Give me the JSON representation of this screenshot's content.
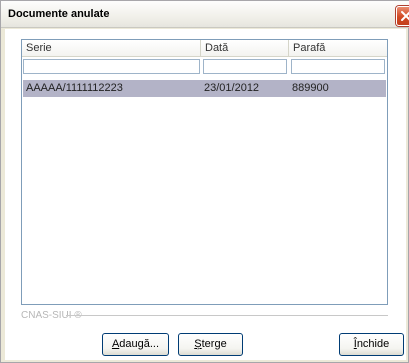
{
  "window": {
    "title": "Documente anulate"
  },
  "grid": {
    "columns": [
      "Serie",
      "Dată",
      "Parafă"
    ],
    "rows": [
      {
        "serie": "AAAAA/1111112223",
        "data": "23/01/2012",
        "parafa": "889900"
      }
    ]
  },
  "footer": {
    "watermark": "CNAS-SIUI ®"
  },
  "buttons": {
    "add": {
      "accel": "A",
      "rest": "daugă..."
    },
    "delete": {
      "accel": "Ș",
      "rest": "terge"
    },
    "close": {
      "accel": "Î",
      "rest": "nchide"
    }
  },
  "colors": {
    "selected_row": "#b3b3c7",
    "close_button": "#d14a24"
  }
}
